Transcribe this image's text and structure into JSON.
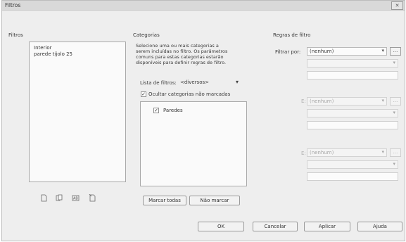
{
  "dialog": {
    "title": "Filtros",
    "close_label": "✕"
  },
  "filters_panel": {
    "heading": "Filtros",
    "items": [
      "Interior",
      "parede tijolo 25"
    ],
    "icons": [
      "new-filter-icon",
      "duplicate-filter-icon",
      "rename-filter-icon",
      "delete-filter-icon"
    ]
  },
  "categories_panel": {
    "heading": "Categorias",
    "description_lines": [
      "Selecione uma ou mais categorias a",
      "serem incluídas no filtro. Os parâmetros",
      "comuns para estas categorias estarão",
      "disponíveis para definir regras de filtro."
    ],
    "filter_list_label": "Lista de filtros:",
    "filter_list_value": "<diversos>",
    "hide_unchecked_label": "Ocultar categorias não marcadas",
    "hide_unchecked_checked": true,
    "categories": [
      {
        "label": "Paredes",
        "checked": true
      }
    ],
    "check_all_label": "Marcar todas",
    "check_none_label": "Não marcar"
  },
  "rules_panel": {
    "heading": "Regras de filtro",
    "filter_by_label": "Filtrar por:",
    "filter_by_value": "(nenhum)",
    "and1_label": "E:",
    "and1_value": "(nenhum)",
    "and2_label": "E:",
    "and2_value": "(nenhum)",
    "ellipsis": "..."
  },
  "footer": {
    "ok_label": "OK",
    "cancel_label": "Cancelar",
    "apply_label": "Aplicar",
    "help_label": "Ajuda"
  }
}
